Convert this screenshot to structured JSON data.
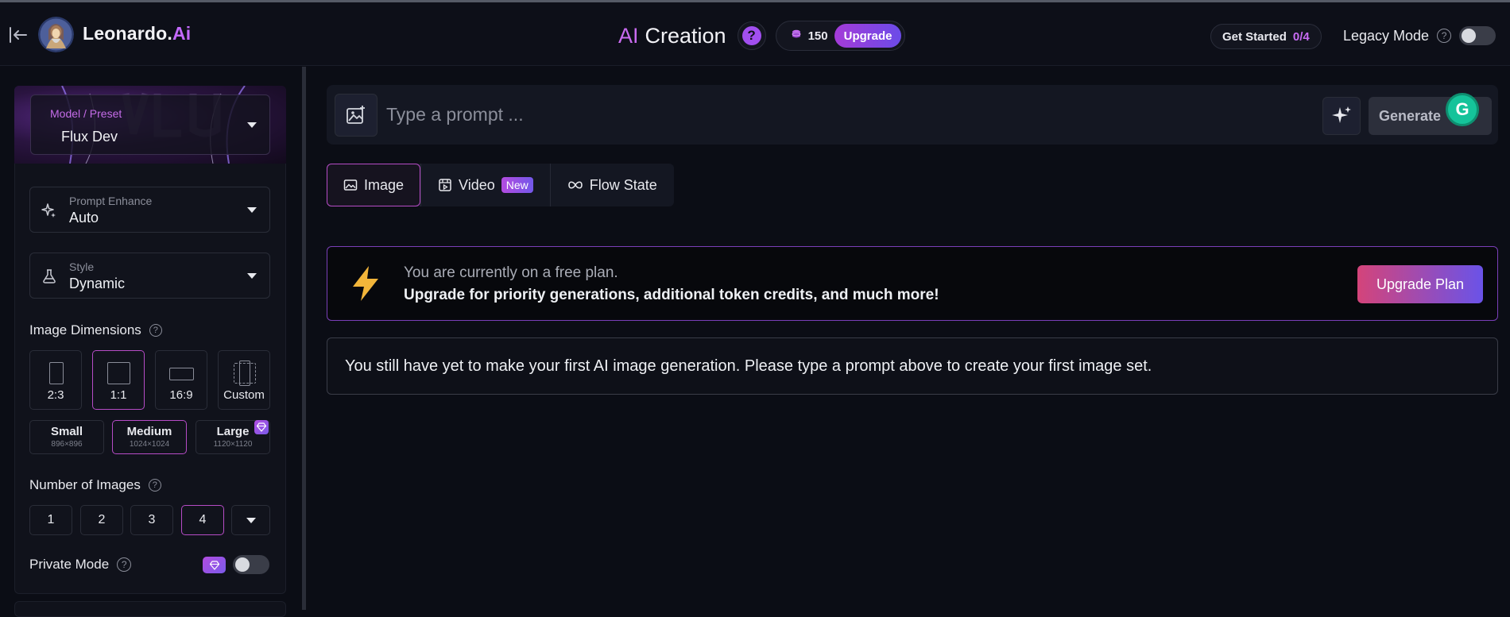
{
  "header": {
    "brand_name": "Leonardo.",
    "brand_suffix": "Ai",
    "title_ai": "AI",
    "title_main": "Creation",
    "help_glyph": "?",
    "token_count": "150",
    "upgrade_label": "Upgrade",
    "get_started_label": "Get Started",
    "get_started_progress": "0/4",
    "legacy_mode_label": "Legacy Mode",
    "legacy_mode_on": false
  },
  "sidebar": {
    "model": {
      "label": "Model / Preset",
      "value": "Flux Dev"
    },
    "prompt_enhance": {
      "label": "Prompt Enhance",
      "value": "Auto"
    },
    "style": {
      "label": "Style",
      "value": "Dynamic"
    },
    "image_dimensions": {
      "label": "Image Dimensions",
      "aspect_ratios": [
        {
          "label": "2:3",
          "active": false
        },
        {
          "label": "1:1",
          "active": true
        },
        {
          "label": "16:9",
          "active": false
        },
        {
          "label": "Custom",
          "active": false
        }
      ],
      "sizes": [
        {
          "name": "Small",
          "dims": "896×896",
          "active": false
        },
        {
          "name": "Medium",
          "dims": "1024×1024",
          "active": true
        },
        {
          "name": "Large",
          "dims": "1120×1120",
          "active": false,
          "premium": true
        }
      ]
    },
    "number_of_images": {
      "label": "Number of Images",
      "options": [
        "1",
        "2",
        "3",
        "4"
      ],
      "selected": "4"
    },
    "private_mode": {
      "label": "Private Mode",
      "on": false
    }
  },
  "prompt": {
    "placeholder": "Type a prompt ...",
    "generate_label": "Generate"
  },
  "tabs": [
    {
      "label": "Image",
      "icon": "image-icon",
      "active": true
    },
    {
      "label": "Video",
      "icon": "video-icon",
      "badge": "New"
    },
    {
      "label": "Flow State",
      "icon": "infinity-icon"
    }
  ],
  "free_plan_banner": {
    "line1": "You are currently on a free plan.",
    "line2": "Upgrade for priority generations, additional token credits, and much more!",
    "button": "Upgrade Plan"
  },
  "empty_state": "You still have yet to make your first AI image generation. Please type a prompt above to create your first image set.",
  "grammarly_glyph": "G",
  "colors": {
    "accent_purple": "#b64cc6",
    "brand_accent": "#c469ff",
    "background": "#0b0d15",
    "upgrade_gradient_start": "#d4447a",
    "upgrade_gradient_end": "#6a53e8"
  }
}
